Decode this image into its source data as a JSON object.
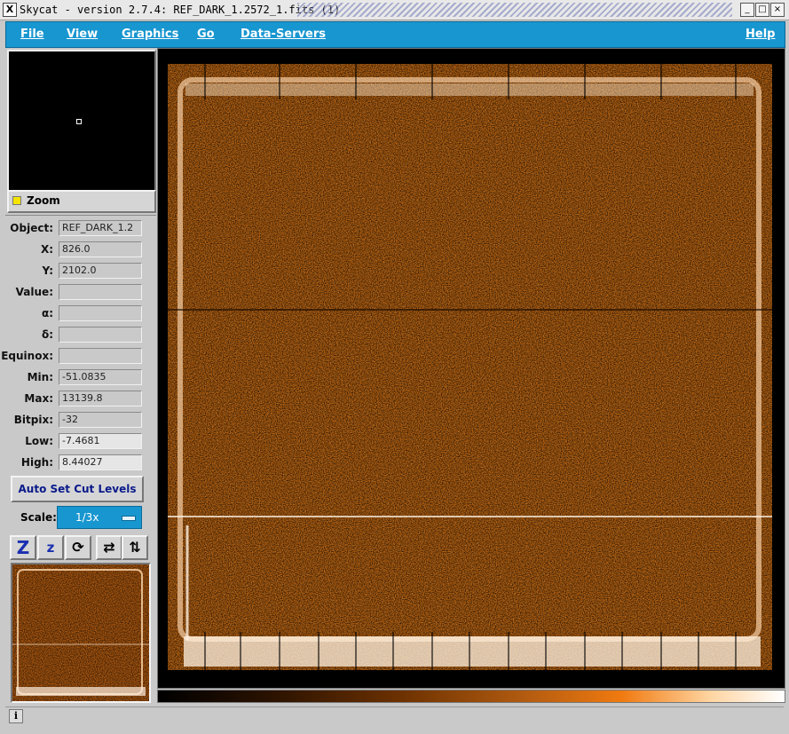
{
  "window": {
    "title": "Skycat - version 2.7.4: REF_DARK_1.2572_1.fits (1)",
    "icon": "x-icon",
    "controls": [
      "_",
      "□",
      "×"
    ]
  },
  "menubar": {
    "items": [
      "File",
      "View",
      "Graphics",
      "Go",
      "Data-Servers"
    ],
    "help": "Help"
  },
  "panel": {
    "zoom_label": "Zoom",
    "fields": [
      {
        "label": "Object:",
        "value": "REF_DARK_1.2"
      },
      {
        "label": "X:",
        "value": "826.0"
      },
      {
        "label": "Y:",
        "value": "2102.0"
      },
      {
        "label": "Value:",
        "value": ""
      },
      {
        "label": "α:",
        "value": ""
      },
      {
        "label": "δ:",
        "value": ""
      },
      {
        "label": "Equinox:",
        "value": ""
      },
      {
        "label": "Min:",
        "value": "-51.0835"
      },
      {
        "label": "Max:",
        "value": "13139.8"
      },
      {
        "label": "Bitpix:",
        "value": "-32"
      },
      {
        "label": "Low:",
        "value": "-7.4681"
      },
      {
        "label": "High:",
        "value": "8.44027"
      }
    ],
    "auto_set_label": "Auto Set Cut Levels",
    "scale_label": "Scale:",
    "scale_value": "1/3x",
    "tools": [
      {
        "icon": "zoom-in-icon",
        "glyph": "Z"
      },
      {
        "icon": "zoom-out-icon",
        "glyph": "z"
      },
      {
        "icon": "rotate-icon",
        "glyph": "⟳"
      },
      {
        "icon": "flip-x-icon",
        "glyph": "⇄"
      },
      {
        "icon": "flip-y-icon",
        "glyph": "⇅"
      }
    ]
  },
  "colors": {
    "menubar": "#1896d0",
    "image_orange": "#b05a10",
    "background": "#c9c9c9"
  },
  "statusbar": {
    "icon": "info-icon",
    "text": ""
  }
}
